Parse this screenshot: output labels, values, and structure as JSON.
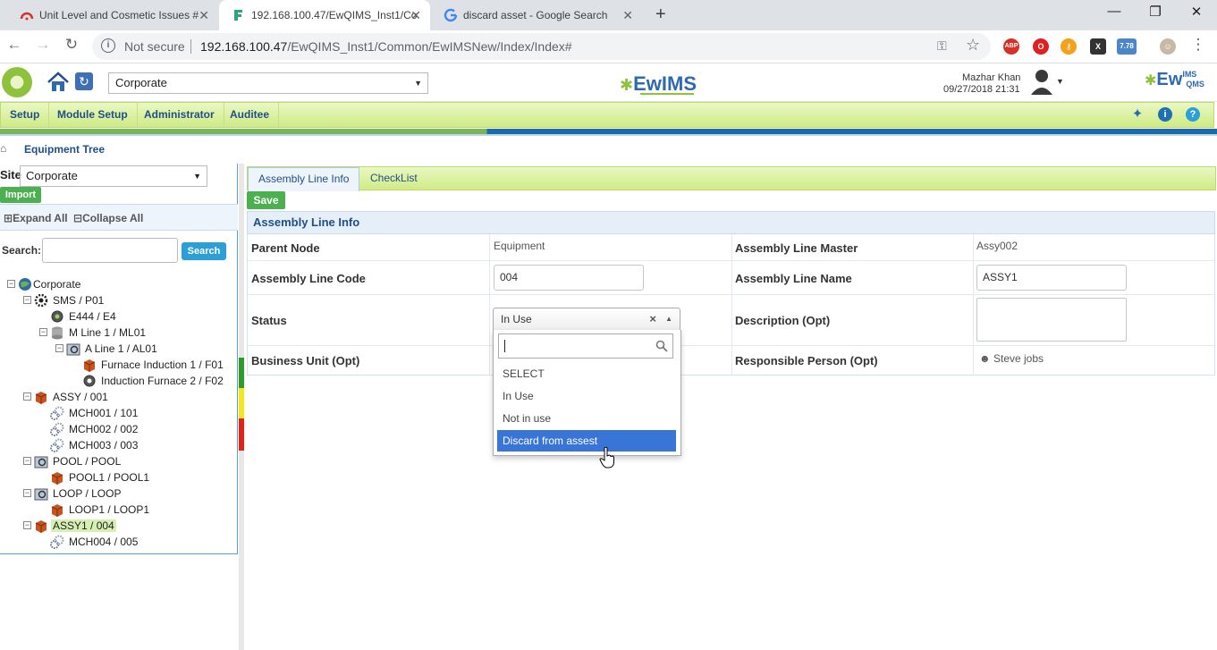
{
  "browser": {
    "tabs": [
      {
        "title": "Unit Level and Cosmetic Issues #"
      },
      {
        "title": "192.168.100.47/EwQIMS_Inst1/Co"
      },
      {
        "title": "discard asset - Google Search"
      }
    ],
    "not_secure": "Not secure",
    "url_host": "192.168.100.47",
    "url_path": "/EwQIMS_Inst1/Common/EwIMSNew/Index/Index#",
    "ext_badge": "7.78",
    "ext_abp": "ABP"
  },
  "header": {
    "site_value": "Corporate",
    "brand": "EwIMS",
    "brand2": "Ew",
    "brand2_sup": "IMS",
    "brand2_sub": "QMS",
    "user_name": "Mazhar Khan",
    "user_date": "09/27/2018 21:31"
  },
  "menu": {
    "items": [
      "Setup",
      "Module Setup",
      "Administrator",
      "Auditee"
    ]
  },
  "breadcrumb": {
    "title": "Equipment Tree"
  },
  "left": {
    "site_label": "Site",
    "site_value": "Corporate",
    "import_label": "Import",
    "expand_all": "Expand All",
    "collapse_all": "Collapse All",
    "search_label": "Search:",
    "search_button": "Search",
    "tree": [
      "Corporate",
      "SMS / P01",
      "E444 / E4",
      "M Line 1 / ML01",
      "A Line 1 / AL01",
      "Furnace Induction 1 / F01",
      "Induction Furnace 2 / F02",
      "ASSY / 001",
      "MCH001 / 101",
      "MCH002 / 002",
      "MCH003 / 003",
      "POOL / POOL",
      "POOL1 / POOL1",
      "LOOP / LOOP",
      "LOOP1 / LOOP1",
      "ASSY1 / 004",
      "MCH004 / 005"
    ]
  },
  "right": {
    "tabs": [
      "Assembly Line Info",
      "CheckList"
    ],
    "save_label": "Save",
    "section_title": "Assembly Line Info",
    "labels": {
      "parent_node": "Parent Node",
      "assembly_line_master": "Assembly Line Master",
      "assembly_line_code": "Assembly Line Code",
      "assembly_line_name": "Assembly Line Name",
      "status": "Status",
      "description": "Description (Opt)",
      "business_unit": "Business Unit (Opt)",
      "responsible_person": "Responsible Person (Opt)"
    },
    "values": {
      "parent_node": "Equipment",
      "assembly_line_master": "Assy002",
      "assembly_line_code": "004",
      "assembly_line_name": "ASSY1",
      "status": "In Use",
      "responsible_person": "Steve jobs"
    },
    "status_options": [
      "SELECT",
      "In Use",
      "Not in use",
      "Discard from assest"
    ]
  },
  "colors": {
    "accent_blue": "#1f4e8a",
    "menu_green": "#cfeb85",
    "save_green": "#4caf50",
    "highlight": "#3875d7"
  }
}
